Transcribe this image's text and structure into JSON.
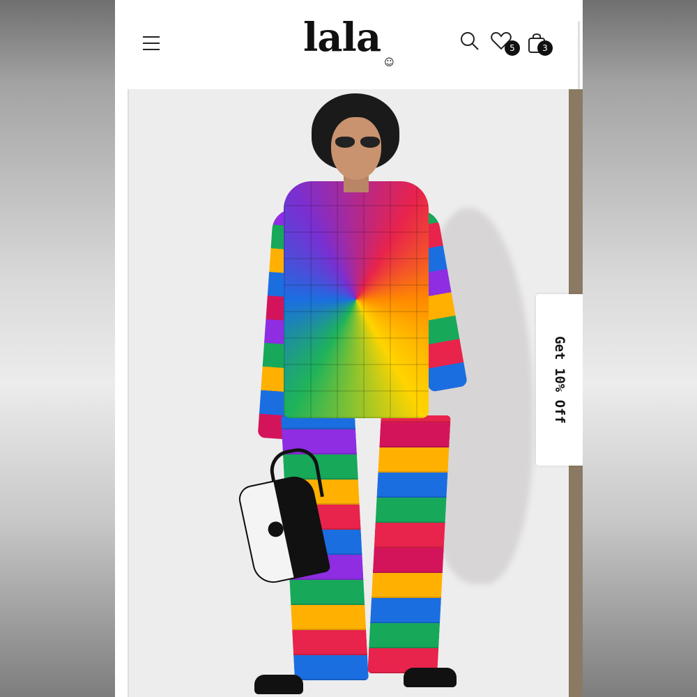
{
  "header": {
    "logo_text": "lala",
    "logo_mark": "☺",
    "menu_icon": "hamburger-menu-icon",
    "search_icon": "search-icon",
    "wishlist_icon": "heart-icon",
    "wishlist_count": "5",
    "cart_icon": "shopping-bag-icon",
    "cart_count": "3"
  },
  "promo": {
    "tab_label": "Get 10% Off"
  },
  "colors": {
    "accent": "#111111",
    "background": "#ffffff",
    "hero_background": "#ededed"
  }
}
